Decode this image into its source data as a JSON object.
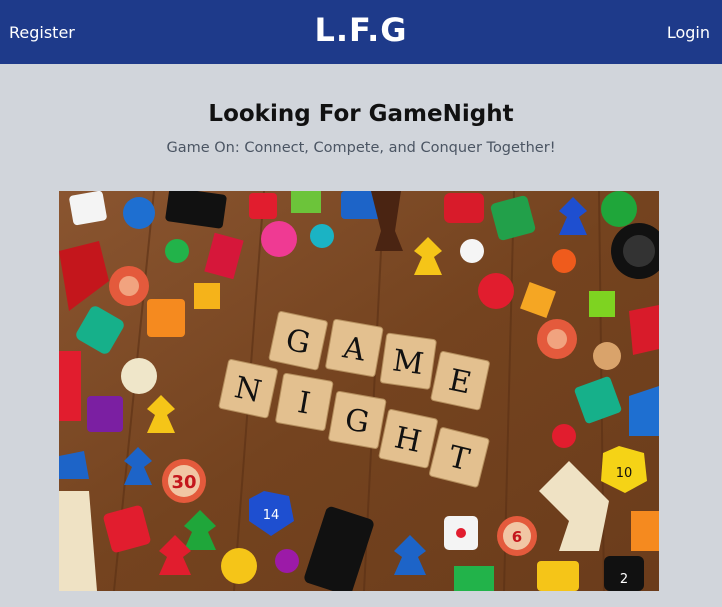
{
  "navbar": {
    "register_label": "Register",
    "brand": "L.F.G",
    "login_label": "Login"
  },
  "hero": {
    "title": "Looking For GameNight",
    "subtitle": "Game On: Connect, Compete, and Conquer Together!"
  },
  "image": {
    "tiles_row1": [
      "G",
      "A",
      "M",
      "E"
    ],
    "tiles_row2": [
      "N",
      "I",
      "G",
      "H",
      "T"
    ],
    "chip_numbers": [
      "30",
      "6"
    ],
    "dice_labels": [
      "14",
      "10",
      "2"
    ]
  },
  "colors": {
    "navbar_bg": "#1e3a8a",
    "page_bg": "#d1d5db",
    "table_wood": "#7a4a26"
  }
}
